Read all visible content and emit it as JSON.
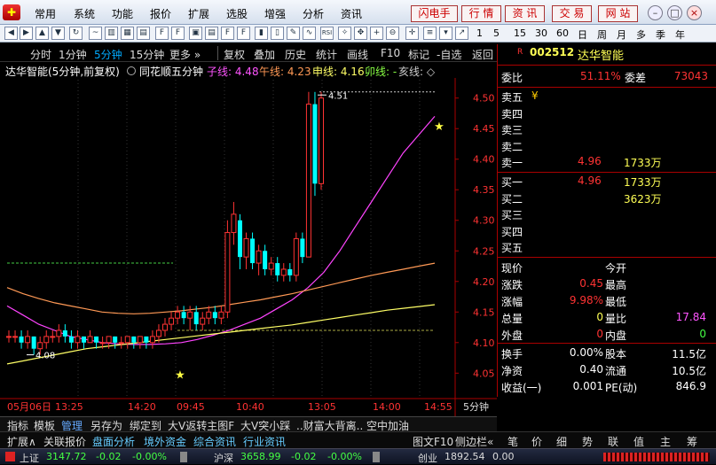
{
  "menu": {
    "items": [
      "常用",
      "系统",
      "功能",
      "报价",
      "扩展",
      "选股",
      "增强",
      "分析",
      "资讯"
    ],
    "right_buttons": [
      "闪电手",
      "行 情",
      "资 讯",
      "交 易",
      "网 站"
    ],
    "window_controls": [
      "–",
      "□",
      "×"
    ]
  },
  "toolbar": {
    "text_items": [
      "1",
      "5",
      "15",
      "30",
      "60",
      "日",
      "周",
      "月",
      "多",
      "季",
      "年"
    ]
  },
  "chart_tabs": {
    "period_tabs": [
      "分时",
      "1分钟",
      "5分钟",
      "15分钟",
      "更多 »"
    ],
    "active_period": "5分钟",
    "tools": [
      "复权",
      "叠加",
      "历史",
      "统计",
      "画线",
      "F10",
      "标记",
      "-自选",
      "返回"
    ]
  },
  "info": {
    "stock_title": "达华智能(5分钟,前复权)",
    "indicator_name": "同花顺五分钟",
    "ma_lines": [
      {
        "label": "子线: 4.48",
        "color": "#ff55ff"
      },
      {
        "label": "午线: 4.23",
        "color": "#ff9955"
      },
      {
        "label": "申线: 4.16",
        "color": "#ffff66"
      },
      {
        "label": "卯线: -",
        "color": "#88ff44"
      },
      {
        "label": "亥线: ◇",
        "color": "#cccccc"
      }
    ]
  },
  "chart_data": {
    "type": "candlestick",
    "ylim": [
      4.02,
      4.53
    ],
    "y_ticks": [
      "4.50",
      "4.45",
      "4.40",
      "4.35",
      "4.30",
      "4.25",
      "4.20",
      "4.15",
      "4.10",
      "4.05"
    ],
    "x_ticks": [
      "05月06日",
      "13:25",
      "14:20",
      "09:45",
      "10:40",
      "13:05",
      "14:00",
      "14:55"
    ],
    "period_label": "5分钟",
    "annotations": {
      "high_label": "4.51",
      "low_label": "4.08"
    },
    "candles": [
      {
        "o": 4.11,
        "c": 4.11,
        "h": 4.12,
        "l": 4.1
      },
      {
        "o": 4.11,
        "c": 4.11,
        "h": 4.12,
        "l": 4.1
      },
      {
        "o": 4.11,
        "c": 4.1,
        "h": 4.12,
        "l": 4.09
      },
      {
        "o": 4.1,
        "c": 4.11,
        "h": 4.12,
        "l": 4.09
      },
      {
        "o": 4.11,
        "c": 4.09,
        "h": 4.11,
        "l": 4.08
      },
      {
        "o": 4.09,
        "c": 4.1,
        "h": 4.11,
        "l": 4.08
      },
      {
        "o": 4.1,
        "c": 4.11,
        "h": 4.12,
        "l": 4.09
      },
      {
        "o": 4.11,
        "c": 4.11,
        "h": 4.12,
        "l": 4.1
      },
      {
        "o": 4.11,
        "c": 4.12,
        "h": 4.13,
        "l": 4.1
      },
      {
        "o": 4.12,
        "c": 4.11,
        "h": 4.13,
        "l": 4.1
      },
      {
        "o": 4.11,
        "c": 4.1,
        "h": 4.12,
        "l": 4.09
      },
      {
        "o": 4.1,
        "c": 4.11,
        "h": 4.12,
        "l": 4.09
      },
      {
        "o": 4.11,
        "c": 4.1,
        "h": 4.11,
        "l": 4.09
      },
      {
        "o": 4.1,
        "c": 4.11,
        "h": 4.12,
        "l": 4.1
      },
      {
        "o": 4.11,
        "c": 4.1,
        "h": 4.11,
        "l": 4.09
      },
      {
        "o": 4.1,
        "c": 4.1,
        "h": 4.11,
        "l": 4.09
      },
      {
        "o": 4.1,
        "c": 4.11,
        "h": 4.11,
        "l": 4.09
      },
      {
        "o": 4.11,
        "c": 4.1,
        "h": 4.11,
        "l": 4.09
      },
      {
        "o": 4.1,
        "c": 4.1,
        "h": 4.11,
        "l": 4.09
      },
      {
        "o": 4.1,
        "c": 4.11,
        "h": 4.11,
        "l": 4.09
      },
      {
        "o": 4.11,
        "c": 4.1,
        "h": 4.11,
        "l": 4.09
      },
      {
        "o": 4.1,
        "c": 4.11,
        "h": 4.11,
        "l": 4.09
      },
      {
        "o": 4.11,
        "c": 4.1,
        "h": 4.11,
        "l": 4.09
      },
      {
        "o": 4.1,
        "c": 4.11,
        "h": 4.12,
        "l": 4.09
      },
      {
        "o": 4.11,
        "c": 4.12,
        "h": 4.13,
        "l": 4.1
      },
      {
        "o": 4.12,
        "c": 4.13,
        "h": 4.14,
        "l": 4.11
      },
      {
        "o": 4.13,
        "c": 4.14,
        "h": 4.15,
        "l": 4.12
      },
      {
        "o": 4.14,
        "c": 4.15,
        "h": 4.16,
        "l": 4.13
      },
      {
        "o": 4.15,
        "c": 4.14,
        "h": 4.16,
        "l": 4.13
      },
      {
        "o": 4.14,
        "c": 4.15,
        "h": 4.16,
        "l": 4.12
      },
      {
        "o": 4.15,
        "c": 4.13,
        "h": 4.16,
        "l": 4.12
      },
      {
        "o": 4.13,
        "c": 4.14,
        "h": 4.15,
        "l": 4.12
      },
      {
        "o": 4.14,
        "c": 4.15,
        "h": 4.16,
        "l": 4.13
      },
      {
        "o": 4.15,
        "c": 4.14,
        "h": 4.16,
        "l": 4.13
      },
      {
        "o": 4.14,
        "c": 4.15,
        "h": 4.16,
        "l": 4.13
      },
      {
        "o": 4.15,
        "c": 4.28,
        "h": 4.3,
        "l": 4.14
      },
      {
        "o": 4.28,
        "c": 4.31,
        "h": 4.33,
        "l": 4.26
      },
      {
        "o": 4.3,
        "c": 4.24,
        "h": 4.31,
        "l": 4.22
      },
      {
        "o": 4.24,
        "c": 4.27,
        "h": 4.28,
        "l": 4.22
      },
      {
        "o": 4.27,
        "c": 4.23,
        "h": 4.28,
        "l": 4.22
      },
      {
        "o": 4.23,
        "c": 4.25,
        "h": 4.26,
        "l": 4.21
      },
      {
        "o": 4.25,
        "c": 4.22,
        "h": 4.26,
        "l": 4.21
      },
      {
        "o": 4.22,
        "c": 4.23,
        "h": 4.24,
        "l": 4.21
      },
      {
        "o": 4.23,
        "c": 4.21,
        "h": 4.24,
        "l": 4.2
      },
      {
        "o": 4.21,
        "c": 4.22,
        "h": 4.23,
        "l": 4.2
      },
      {
        "o": 4.22,
        "c": 4.21,
        "h": 4.23,
        "l": 4.2
      },
      {
        "o": 4.21,
        "c": 4.27,
        "h": 4.28,
        "l": 4.2
      },
      {
        "o": 4.27,
        "c": 4.24,
        "h": 4.28,
        "l": 4.23
      },
      {
        "o": 4.24,
        "c": 4.49,
        "h": 4.51,
        "l": 4.24
      },
      {
        "o": 4.49,
        "c": 4.36,
        "h": 4.51,
        "l": 4.34
      },
      {
        "o": 4.36,
        "c": 4.5,
        "h": 4.51,
        "l": 4.35
      }
    ],
    "ma_series": [
      {
        "name": "子线",
        "color": "#ff44ff",
        "values": [
          4.16,
          4.145,
          4.13,
          4.12,
          4.11,
          4.105,
          4.1,
          4.098,
          4.097,
          4.097,
          4.098,
          4.1,
          4.105,
          4.112,
          4.12,
          4.13,
          4.14,
          4.155,
          4.17,
          4.19,
          4.215,
          4.25,
          4.29,
          4.33,
          4.37,
          4.41,
          4.44,
          4.47
        ]
      },
      {
        "name": "午线",
        "color": "#ff9955",
        "values": [
          4.19,
          4.18,
          4.172,
          4.165,
          4.16,
          4.155,
          4.15,
          4.148,
          4.147,
          4.148,
          4.15,
          4.152,
          4.155,
          4.158,
          4.162,
          4.166,
          4.17,
          4.175,
          4.18,
          4.186,
          4.192,
          4.198,
          4.204,
          4.21,
          4.215,
          4.22,
          4.225,
          4.23
        ]
      },
      {
        "name": "申线",
        "color": "#ffff66",
        "values": [
          4.065,
          4.07,
          4.075,
          4.08,
          4.085,
          4.09,
          4.093,
          4.096,
          4.099,
          4.102,
          4.105,
          4.108,
          4.111,
          4.114,
          4.117,
          4.12,
          4.123,
          4.126,
          4.129,
          4.133,
          4.137,
          4.141,
          4.145,
          4.149,
          4.153,
          4.156,
          4.159,
          4.162
        ]
      }
    ],
    "green_dashed_level": 4.23,
    "yellow_dashed_level": 4.12,
    "white_dashed_level": 4.51
  },
  "quote": {
    "code": "002512",
    "name": "达华智能",
    "wei_bi_label": "委比",
    "wei_bi": "51.11%",
    "wei_cha_label": "委差",
    "wei_cha": "73043",
    "sell": [
      {
        "label": "卖五",
        "price": "",
        "vol": "",
        "mark": "¥"
      },
      {
        "label": "卖四",
        "price": "",
        "vol": ""
      },
      {
        "label": "卖三",
        "price": "",
        "vol": ""
      },
      {
        "label": "卖二",
        "price": "",
        "vol": ""
      },
      {
        "label": "卖一",
        "price": "4.96",
        "vol": "1733万"
      }
    ],
    "buy": [
      {
        "label": "买一",
        "price": "4.96",
        "vol": "1733万"
      },
      {
        "label": "买二",
        "price": "",
        "vol": "3623万"
      },
      {
        "label": "买三",
        "price": "",
        "vol": ""
      },
      {
        "label": "买四",
        "price": "",
        "vol": ""
      },
      {
        "label": "买五",
        "price": "",
        "vol": ""
      }
    ],
    "stats": [
      {
        "l1": "现价",
        "v1": "",
        "l2": "今开",
        "v2": ""
      },
      {
        "l1": "涨跌",
        "v1": "0.45",
        "l2": "最高",
        "v2": ""
      },
      {
        "l1": "涨幅",
        "v1": "9.98%",
        "l2": "最低",
        "v2": ""
      },
      {
        "l1": "总量",
        "v1": "0",
        "l2": "量比",
        "v2": "17.84"
      },
      {
        "l1": "外盘",
        "v1": "0",
        "l2": "内盘",
        "v2": "0"
      }
    ],
    "fin": [
      {
        "l1": "换手",
        "v1": "0.00%",
        "l2": "股本",
        "v2": "11.5亿"
      },
      {
        "l1": "净资",
        "v1": "0.40",
        "l2": "流通",
        "v2": "10.5亿"
      },
      {
        "l1": "收益(一)",
        "v1": "0.001",
        "l2": "PE(动)",
        "v2": "846.9"
      }
    ]
  },
  "bottom_tabs": [
    "指标",
    "模板",
    "管理",
    "另存为",
    "绑定到",
    "大V返转主图F",
    "大V突小踩",
    "..财富大背离..",
    "空中加油"
  ],
  "bottom_tabs2": {
    "left": [
      "扩展∧",
      "关联报价",
      "盘面分析",
      "境外资金",
      "综合资讯",
      "行业资讯"
    ],
    "right_mid": "图文F10",
    "right_mid2": "侧边栏«",
    "right_icons": [
      "笔",
      "价",
      "细",
      "势",
      "联",
      "值",
      "主",
      "筹"
    ]
  },
  "status": {
    "items": [
      {
        "name": "上证",
        "value": "3147.72",
        "change": "-0.02",
        "pct": "-0.00%"
      },
      {
        "name": "沪深",
        "value": "3658.99",
        "change": "-0.02",
        "pct": "-0.00%"
      },
      {
        "name": "创业",
        "value": "1892.54",
        "change": "0.00",
        "pct": ""
      }
    ]
  }
}
